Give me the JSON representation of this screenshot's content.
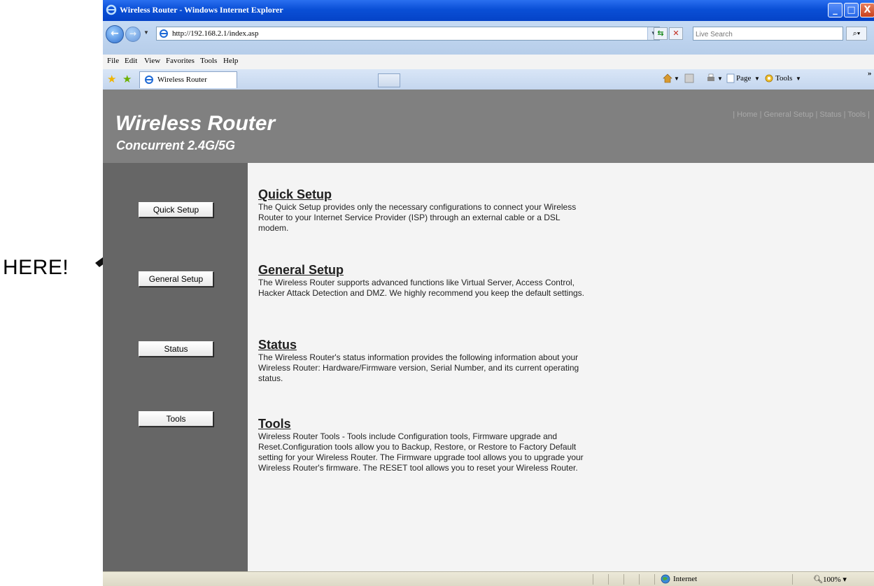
{
  "annotation": {
    "text": "HERE!"
  },
  "window": {
    "title": "Wireless Router - Windows Internet Explorer",
    "controls": {
      "minimize": "_",
      "maximize": "□",
      "close": "X"
    }
  },
  "address_bar": {
    "url": "http://192.168.2.1/index.asp",
    "search_placeholder": "Live Search"
  },
  "menu": [
    {
      "label": "File"
    },
    {
      "label": "Edit"
    },
    {
      "label": "View"
    },
    {
      "label": "Favorites"
    },
    {
      "label": "Tools"
    },
    {
      "label": "Help"
    }
  ],
  "tabs": [
    {
      "label": "Wireless Router"
    }
  ],
  "command_bar": {
    "page": "Page",
    "tools": "Tools",
    "chevron": "»"
  },
  "page": {
    "brand_title": "Wireless Router",
    "brand_subtitle": "Concurrent 2.4G/5G",
    "top_nav": {
      "sep": "|",
      "home": "Home",
      "general": "General Setup",
      "status": "Status",
      "tools": "Tools"
    },
    "sidebar_buttons": [
      {
        "label": "Quick Setup"
      },
      {
        "label": "General Setup"
      },
      {
        "label": "Status"
      },
      {
        "label": "Tools"
      }
    ],
    "sections": [
      {
        "title": "Quick Setup",
        "body": "The Quick Setup provides only the necessary configurations to connect your Wireless Router to your Internet Service Provider (ISP) through an external cable or a DSL modem."
      },
      {
        "title": "General Setup",
        "body": "The Wireless Router supports advanced functions like Virtual Server, Access Control, Hacker Attack Detection and DMZ. We highly recommend you keep the default settings."
      },
      {
        "title": "Status",
        "body": "The Wireless Router's status information provides the following information about your Wireless Router: Hardware/Firmware version, Serial Number, and its current operating status."
      },
      {
        "title": "Tools",
        "body": "Wireless Router Tools - Tools include Configuration tools, Firmware upgrade and Reset.Configuration tools allow you to Backup, Restore, or Restore to Factory Default setting for your Wireless Router. The Firmware upgrade tool allows you to upgrade your Wireless Router's firmware. The RESET tool allows you to reset your Wireless Router."
      }
    ]
  },
  "status_bar": {
    "zone": "Internet",
    "zoom": "100%"
  },
  "colors": {
    "banner": "#808080",
    "sidebar": "#666666",
    "title_bar": "#0a4fd6"
  }
}
